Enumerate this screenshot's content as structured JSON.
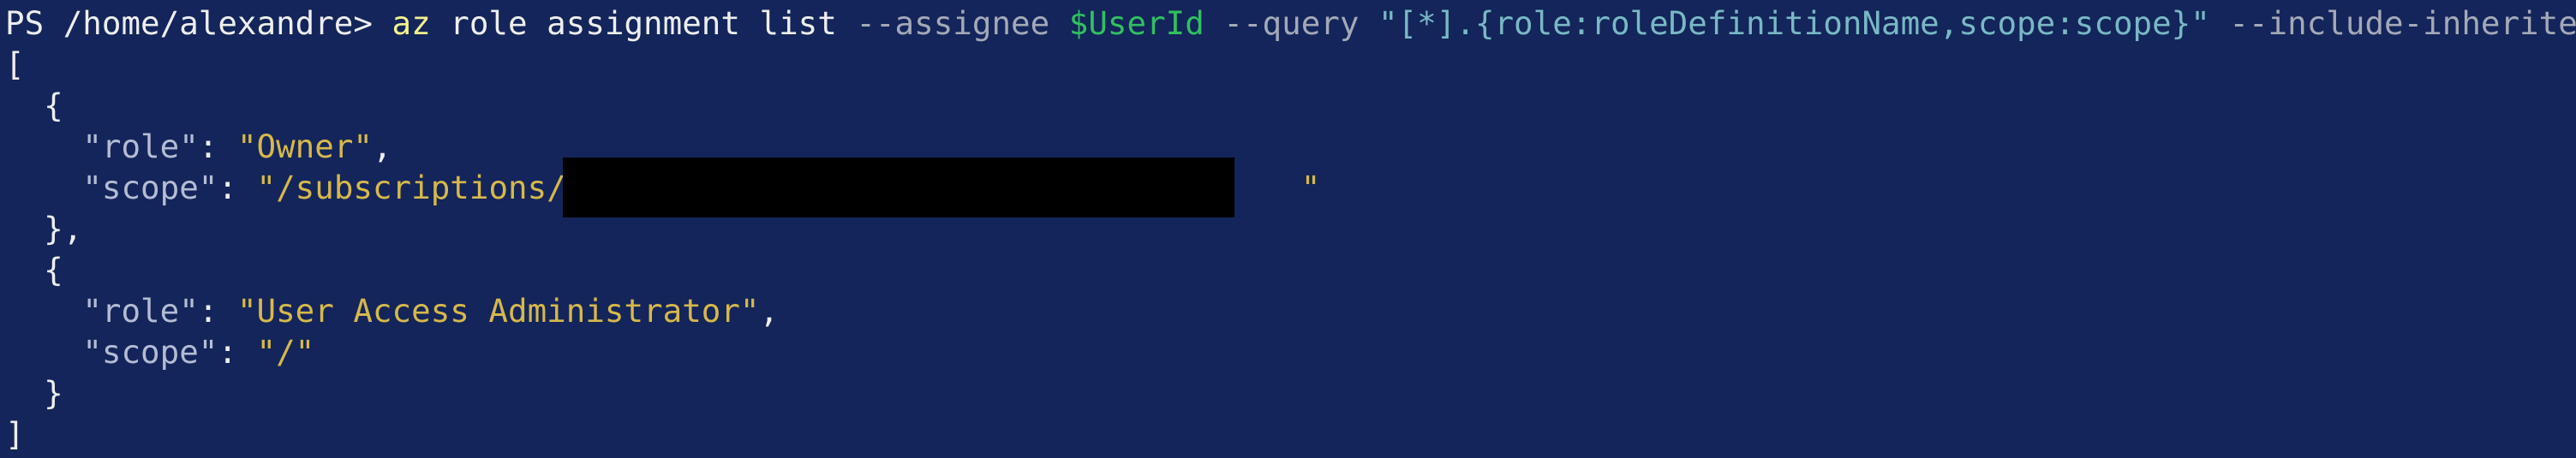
{
  "prompt": {
    "prefix": "PS /home/alexandre> ",
    "command": "az",
    "args": "role assignment list",
    "assignee_flag": "--assignee",
    "variable": "$UserId",
    "query_flag": "--query",
    "query_value": "\"[*].{role:roleDefinitionName,scope:scope}\"",
    "inherited_flag": "--include-inherited"
  },
  "output": {
    "open_bracket": "[",
    "close_bracket": "]",
    "open_brace": "{",
    "close_brace": "}",
    "close_brace_comma": "},",
    "role_key": "\"role\"",
    "scope_key": "\"scope\"",
    "entries": [
      {
        "role": "\"Owner\"",
        "scope_visible": "\"/subscriptions/c",
        "scope_tail": "\""
      },
      {
        "role": "\"User Access Administrator\"",
        "scope_visible": "\"/\""
      }
    ]
  },
  "colors": {
    "background": "#13255a",
    "text": "#eeeeee",
    "command": "#f2f28c",
    "flag": "#a4a9b7",
    "variable": "#30c060",
    "query_string": "#79b8c4",
    "json_key": "#b4bcd4",
    "json_string": "#d7b84a",
    "redaction": "#000000"
  }
}
